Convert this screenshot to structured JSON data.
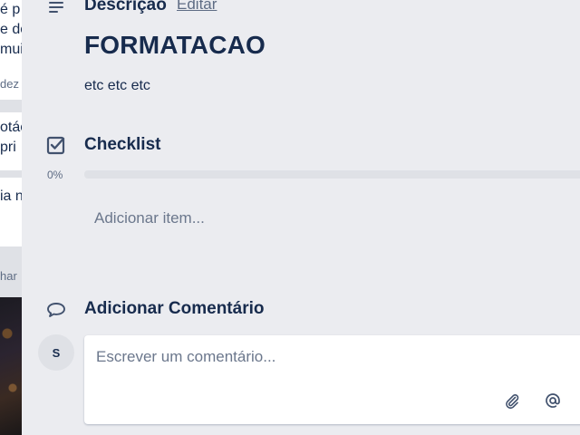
{
  "background": {
    "cards": [
      {
        "lines": [
          "é p",
          "e do",
          "mui"
        ]
      },
      {
        "meta": "dez"
      },
      {
        "lines": [
          "otác",
          " pri"
        ]
      },
      {
        "lines": [
          "ia n"
        ]
      },
      {
        "meta": "har"
      }
    ]
  },
  "description": {
    "icon": "description-lines-icon",
    "title": "Descrição",
    "edit_label": "Editar",
    "heading": "FORMATACAO",
    "body": "etc etc etc"
  },
  "checklist": {
    "icon": "checkbox-icon",
    "title": "Checklist",
    "progress_label": "0%",
    "progress": 0,
    "add_item_label": "Adicionar item..."
  },
  "comment": {
    "icon": "comment-bubble-icon",
    "title": "Adicionar Comentário",
    "avatar_initial": "S",
    "placeholder": "Escrever um comentário...",
    "attach_icon": "paperclip-icon",
    "mention_icon": "at-sign-icon"
  },
  "colors": {
    "text": "#172b4d",
    "muted": "#5e6c84",
    "modal_bg": "#ebecf0",
    "progress_track": "#dfe1e6"
  }
}
